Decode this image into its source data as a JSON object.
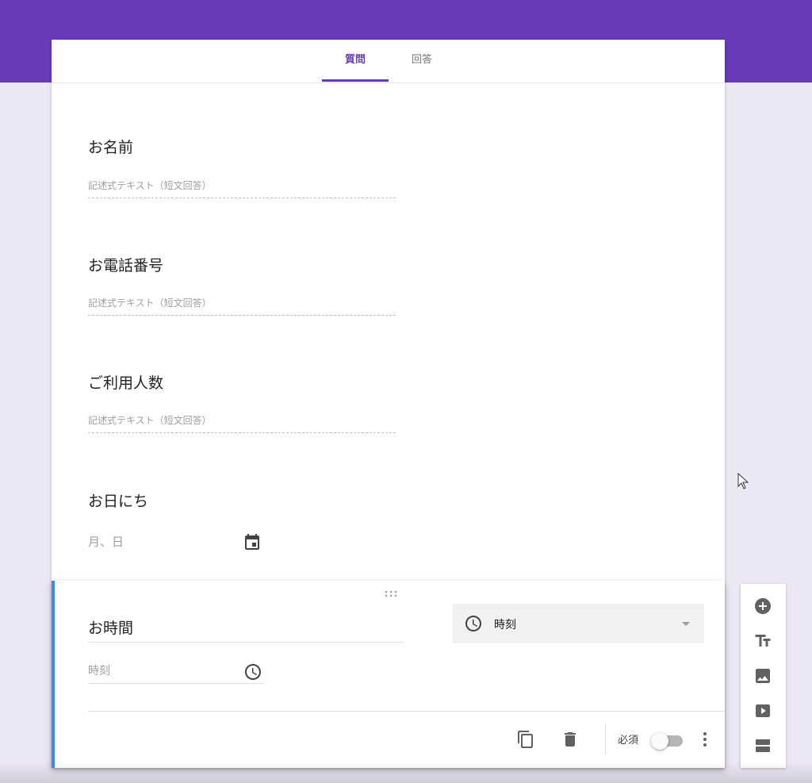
{
  "app": {
    "accent": "#673ab7",
    "background": "#ece7f5",
    "active_border": "#4285f4"
  },
  "tabs": [
    {
      "label": "質問",
      "active": true
    },
    {
      "label": "回答",
      "active": false
    }
  ],
  "questions": [
    {
      "title": "お名前",
      "placeholder": "記述式テキスト（短文回答）"
    },
    {
      "title": "お電話番号",
      "placeholder": "記述式テキスト（短文回答）"
    },
    {
      "title": "ご利用人数",
      "placeholder": "記述式テキスト（短文回答）"
    },
    {
      "title": "お日にち",
      "placeholder": "月、日",
      "icon": "calendar-icon"
    }
  ],
  "active_question": {
    "title": "お時間",
    "type_label": "時刻",
    "type_icon": "clock-icon",
    "answer_placeholder": "時刻",
    "answer_icon": "clock-icon",
    "required_label": "必須",
    "required": false
  },
  "side_toolbar": [
    {
      "icon": "add-circle-icon",
      "label": "add-question"
    },
    {
      "icon": "title-text-icon",
      "label": "add-title"
    },
    {
      "icon": "image-icon",
      "label": "add-image"
    },
    {
      "icon": "video-icon",
      "label": "add-video"
    },
    {
      "icon": "section-icon",
      "label": "add-section"
    }
  ]
}
